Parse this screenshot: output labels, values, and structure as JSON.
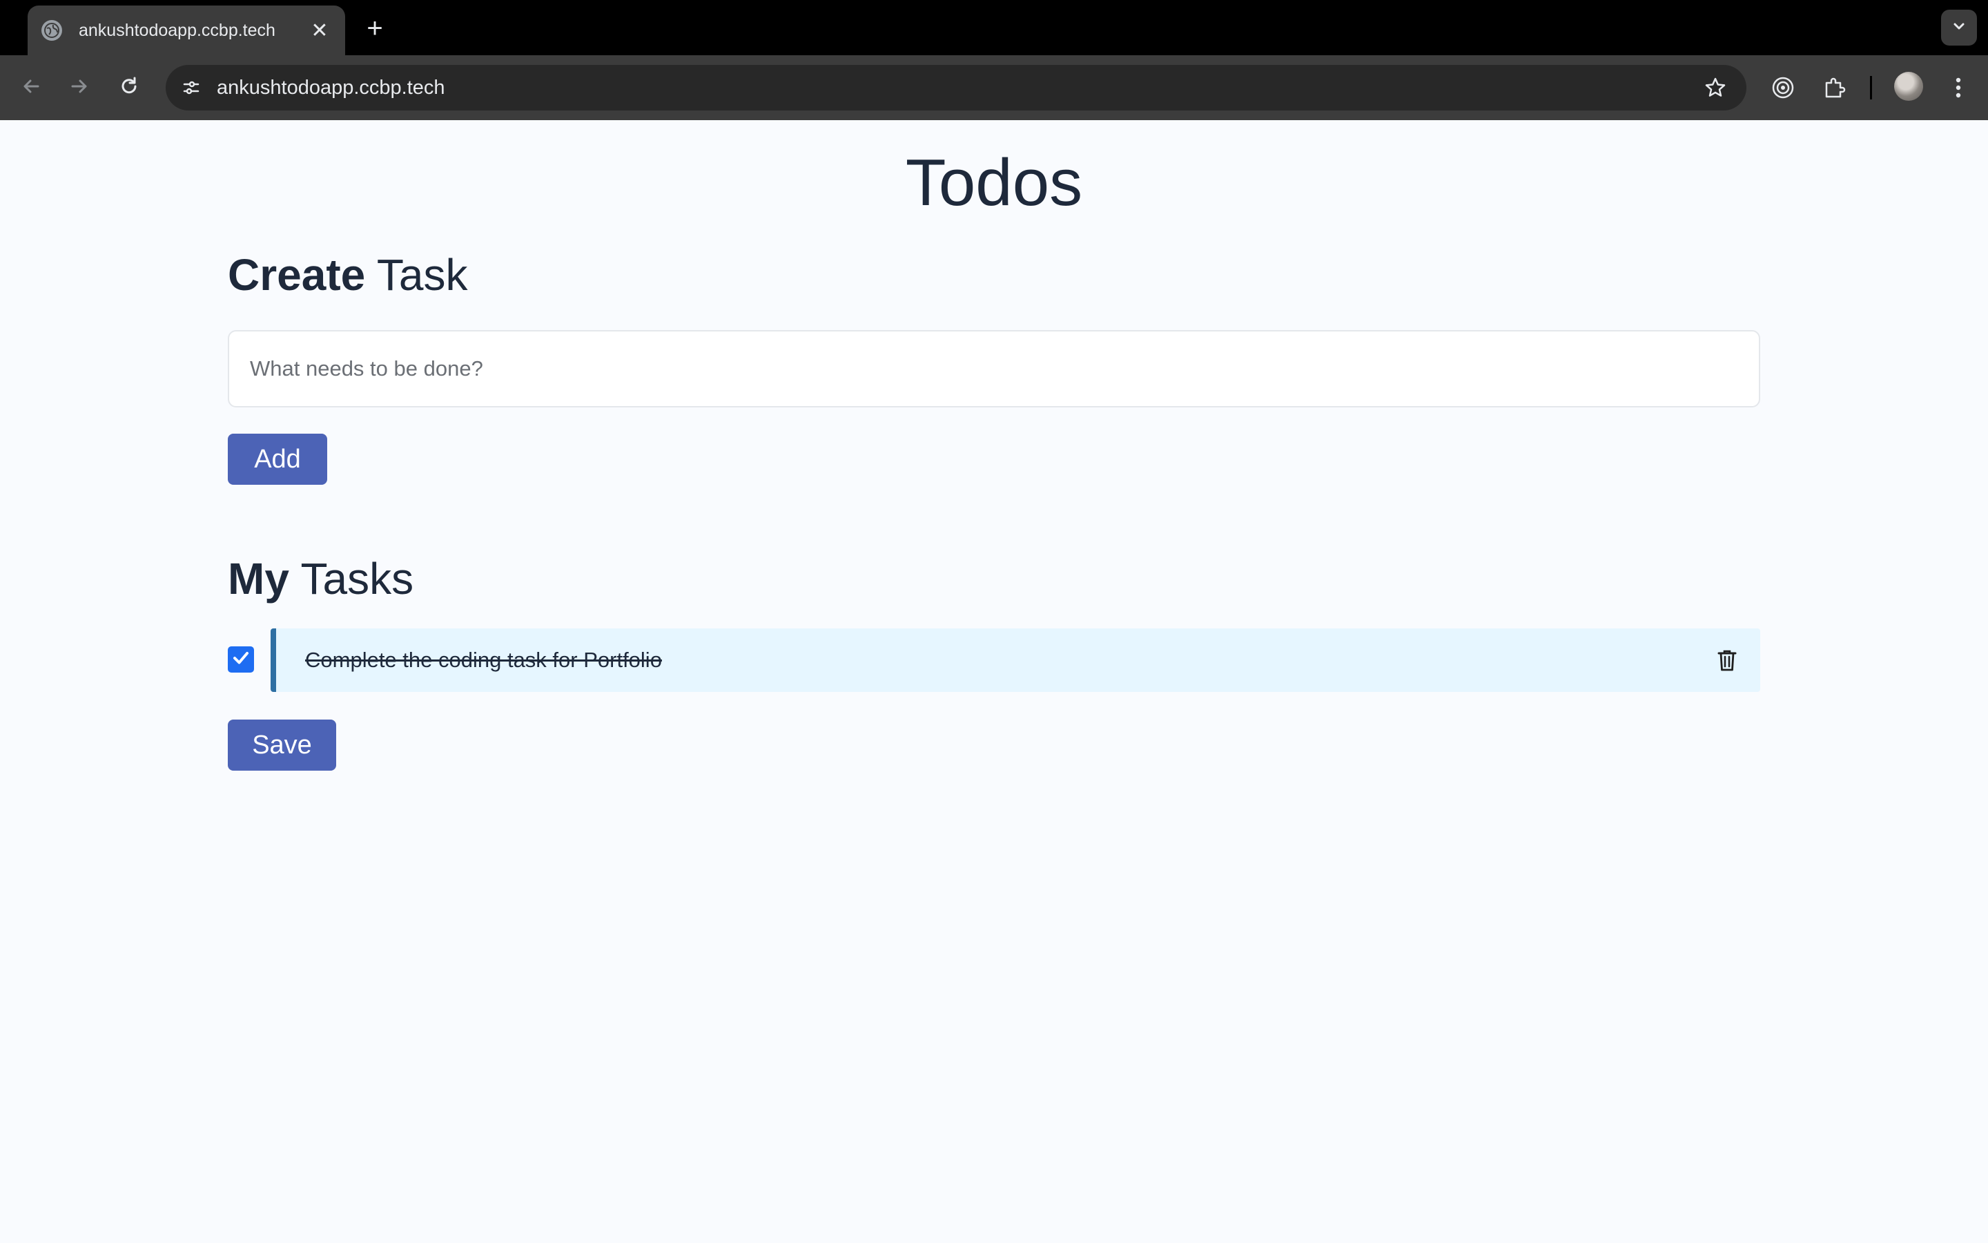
{
  "browser": {
    "tab_title": "ankushtodoapp.ccbp.tech",
    "tab_close_glyph": "✕",
    "new_tab_glyph": "+",
    "url": "ankushtodoapp.ccbp.tech"
  },
  "app": {
    "title": "Todos",
    "create_section": {
      "heading_bold": "Create",
      "heading_rest": " Task",
      "input_placeholder": "What needs to be done?",
      "input_value": "",
      "add_label": "Add"
    },
    "tasks_section": {
      "heading_bold": "My",
      "heading_rest": " Tasks",
      "todos": [
        {
          "label": "Complete the coding task for Portfolio",
          "checked": true
        }
      ],
      "save_label": "Save"
    }
  },
  "colors": {
    "accent_button": "#4c63b6",
    "todo_background": "#e6f6ff",
    "todo_border": "#2e6fa3",
    "checkbox": "#1e6df2",
    "page_background": "#f9fbfe"
  }
}
